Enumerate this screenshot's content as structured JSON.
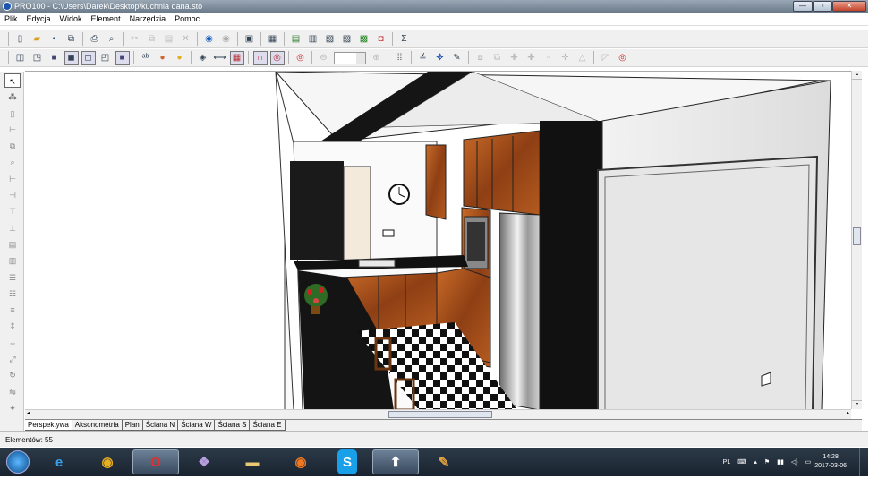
{
  "window": {
    "title": "PRO100 - C:\\Users\\Darek\\Desktop\\kuchnia dana.sto",
    "controls": [
      "—",
      "▫",
      "✕"
    ]
  },
  "menu": [
    "Plik",
    "Edycja",
    "Widok",
    "Element",
    "Narzędzia",
    "Pomoc"
  ],
  "toolbar1": {
    "sigma": "Σ"
  },
  "toolbar2": {
    "zoom_value": ""
  },
  "tabs": [
    "Perspektywa",
    "Aksonometria",
    "Plan",
    "Ściana N",
    "Ściana W",
    "Ściana S",
    "Ściana E"
  ],
  "status": {
    "elements": "Elementów: 55"
  },
  "taskbar": {
    "apps": [
      "start",
      "internet-explorer",
      "chrome",
      "opera",
      "photo-viewer",
      "explorer",
      "firefox",
      "skype",
      "pro100",
      "paint"
    ],
    "lang": "PL",
    "time": "14:28",
    "date": "2017-03-06"
  }
}
